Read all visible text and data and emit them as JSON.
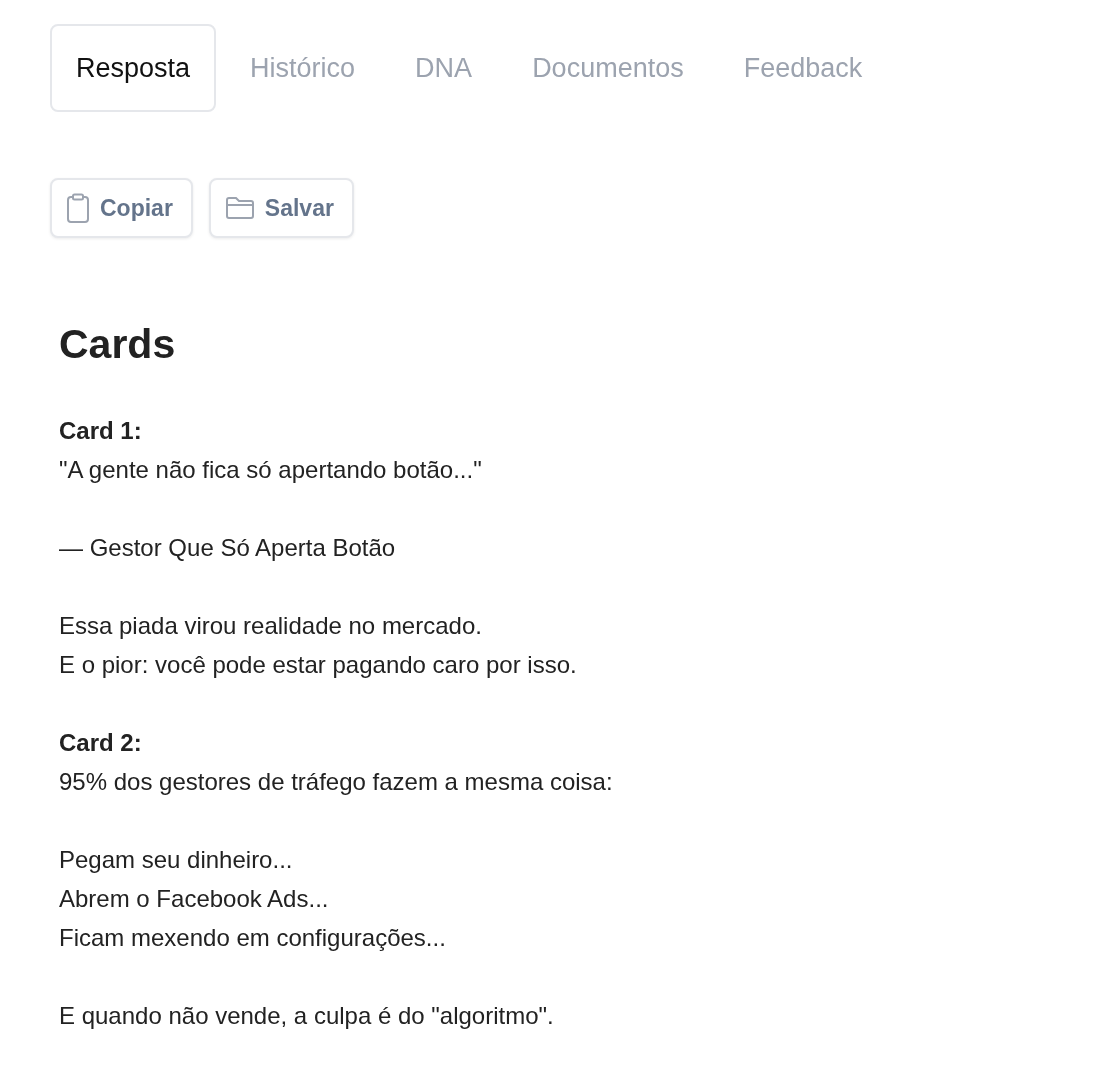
{
  "tabs": [
    {
      "label": "Resposta",
      "selected": true
    },
    {
      "label": "Histórico",
      "selected": false
    },
    {
      "label": "DNA",
      "selected": false
    },
    {
      "label": "Documentos",
      "selected": false
    },
    {
      "label": "Feedback",
      "selected": false
    }
  ],
  "actions": [
    {
      "kind": "copy",
      "label": "Copiar"
    },
    {
      "kind": "save",
      "label": "Salvar"
    }
  ],
  "document": {
    "heading": "Cards",
    "paragraphs": [
      {
        "label": "Card 1:",
        "lines": [
          "\"A gente não fica só apertando botão...\""
        ]
      },
      {
        "lines": [
          "— Gestor Que Só Aperta Botão"
        ]
      },
      {
        "lines": [
          "Essa piada virou realidade no mercado.",
          "E o pior: você pode estar pagando caro por isso."
        ]
      },
      {
        "label": "Card 2:",
        "lines": [
          "95% dos gestores de tráfego fazem a mesma coisa:"
        ]
      },
      {
        "lines": [
          "Pegam seu dinheiro...",
          "Abrem o Facebook Ads...",
          "Ficam mexendo em configurações..."
        ]
      },
      {
        "lines": [
          "E quando não vende, a culpa é do \"algoritmo\"."
        ]
      }
    ]
  }
}
